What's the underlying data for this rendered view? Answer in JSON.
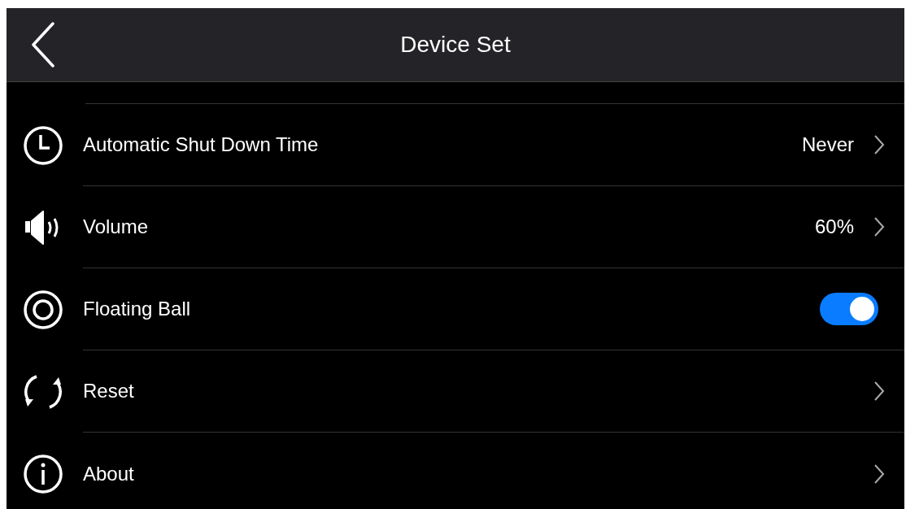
{
  "header": {
    "title": "Device Set"
  },
  "rows": [
    {
      "kind": "link",
      "label": "Automatic Shut Down Time",
      "value": "Never"
    },
    {
      "kind": "link",
      "label": "Volume",
      "value": "60%"
    },
    {
      "kind": "toggle",
      "label": "Floating Ball",
      "on": true
    },
    {
      "kind": "link",
      "label": "Reset"
    },
    {
      "kind": "link",
      "label": "About"
    }
  ]
}
